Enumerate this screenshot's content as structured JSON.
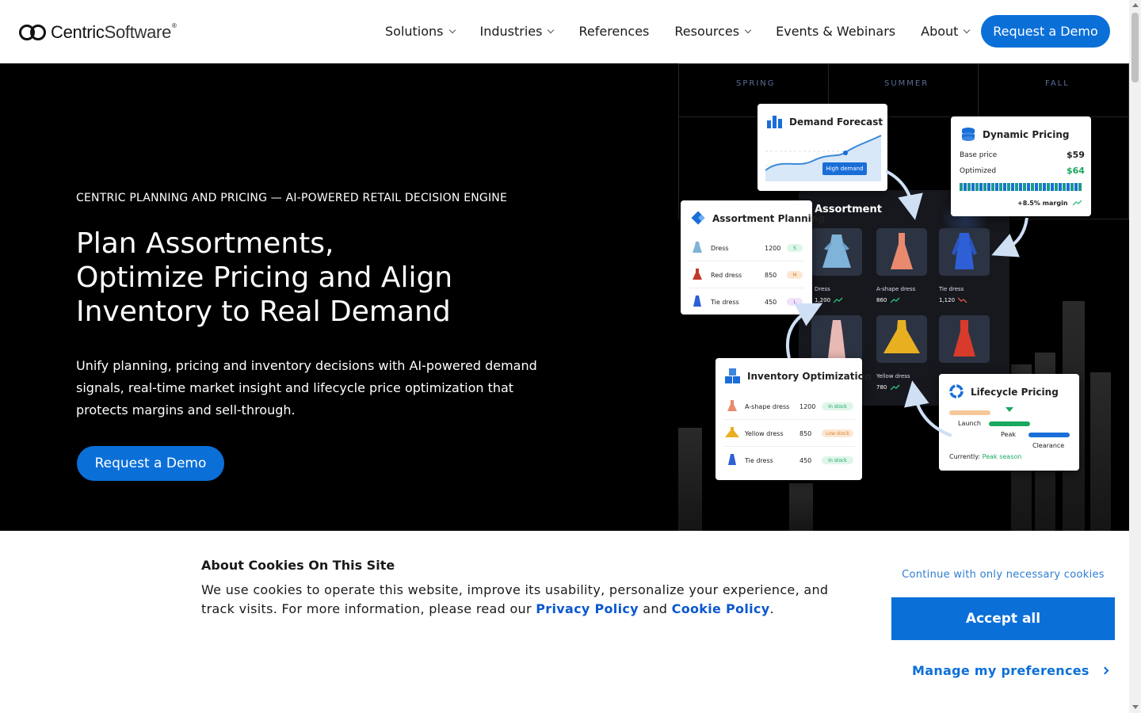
{
  "nav": {
    "logo_text_bold": "Centric",
    "logo_text_thin": "Software",
    "logo_reg": "®",
    "items": [
      {
        "label": "Solutions",
        "has_dropdown": true
      },
      {
        "label": "Industries",
        "has_dropdown": true
      },
      {
        "label": "References",
        "has_dropdown": false
      },
      {
        "label": "Resources",
        "has_dropdown": true
      },
      {
        "label": "Events & Webinars",
        "has_dropdown": false
      },
      {
        "label": "About",
        "has_dropdown": true
      }
    ],
    "cta": "Request a Demo"
  },
  "hero": {
    "eyebrow": "CENTRIC PLANNING AND PRICING — AI-POWERED RETAIL DECISION ENGINE",
    "headline_lines": [
      "Plan Assortments,",
      "Optimize Pricing and Align",
      "Inventory to Real Demand"
    ],
    "subtext": "Unify planning, pricing and inventory decisions with AI-powered demand signals, real-time market insight and lifecycle price optimization that protects margins and sell-through.",
    "cta": "Request a Demo"
  },
  "illustration": {
    "seasons": [
      "SPRING",
      "SUMMER",
      "FALL"
    ],
    "demand_forecast": {
      "title": "Demand Forecast",
      "tag": "High demand"
    },
    "dynamic_pricing": {
      "title": "Dynamic Pricing",
      "base_label": "Base price",
      "base_value": "$59",
      "optimized_label": "Optimized",
      "optimized_value": "$64",
      "margin": "+8.5% margin"
    },
    "assortment": {
      "title": "Assortment",
      "tiles": [
        {
          "label": "Dress",
          "value": "1,200",
          "trend": "up"
        },
        {
          "label": "A-shape dress",
          "value": "860",
          "trend": "up"
        },
        {
          "label": "Tie dress",
          "value": "1,120",
          "trend": "down"
        },
        {
          "label": "",
          "value": "",
          "trend": ""
        },
        {
          "label": "Yellow dress",
          "value": "780",
          "trend": "up"
        },
        {
          "label": "",
          "value": "",
          "trend": ""
        }
      ]
    },
    "assortment_planning": {
      "title": "Assortment Planning",
      "rows": [
        {
          "name": "Dress",
          "qty": "1200",
          "size": "S"
        },
        {
          "name": "Red dress",
          "qty": "850",
          "size": "M"
        },
        {
          "name": "Tie dress",
          "qty": "450",
          "size": "L"
        }
      ]
    },
    "inventory_optimization": {
      "title": "Inventory Optimization",
      "rows": [
        {
          "name": "A-shape dress",
          "qty": "1200",
          "status": "In stock"
        },
        {
          "name": "Yellow dress",
          "qty": "850",
          "status": "Low stock"
        },
        {
          "name": "Tie dress",
          "qty": "450",
          "status": "In stock"
        }
      ]
    },
    "lifecycle_pricing": {
      "title": "Lifecycle Pricing",
      "phases": [
        "Launch",
        "Peak",
        "Clearance"
      ],
      "currently_label": "Currently:",
      "currently_value": "Peak season"
    }
  },
  "cookie": {
    "title": "About Cookies On This Site",
    "text_before": "We use cookies to operate this website, improve its usability, personalize your experience, and track visits. For more information, please read our ",
    "privacy": "Privacy Policy",
    "and": " and ",
    "cookie_policy": "Cookie Policy",
    "period": ".",
    "necessary": "Continue with only necessary cookies",
    "accept": "Accept all",
    "manage": "Manage my preferences"
  },
  "colors": {
    "brand_blue": "#0b6fd8",
    "link_blue": "#0b57d0",
    "hero_bg": "#000000"
  }
}
